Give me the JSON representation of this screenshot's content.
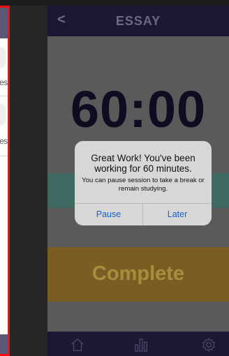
{
  "left_card": {
    "fragment_1": "es",
    "fragment_2": "es"
  },
  "header": {
    "back_label": "<",
    "title": "ESSAY"
  },
  "timer": {
    "display": "60:00"
  },
  "complete_button": {
    "label": "Complete"
  },
  "alert": {
    "title": "Great Work! You've been working for 60 minutes.",
    "message": "You can pause session to take a break or remain studying.",
    "pause_label": "Pause",
    "later_label": "Later"
  },
  "tabbar": {
    "icons": [
      "home-icon",
      "stats-icon",
      "gear-icon"
    ]
  },
  "colors": {
    "nav": "#1b1834",
    "alert_button": "#1a5fd0",
    "highlight_border": "#ff0a0a",
    "teal": "#3f6a64",
    "complete": "#7a5d22"
  }
}
